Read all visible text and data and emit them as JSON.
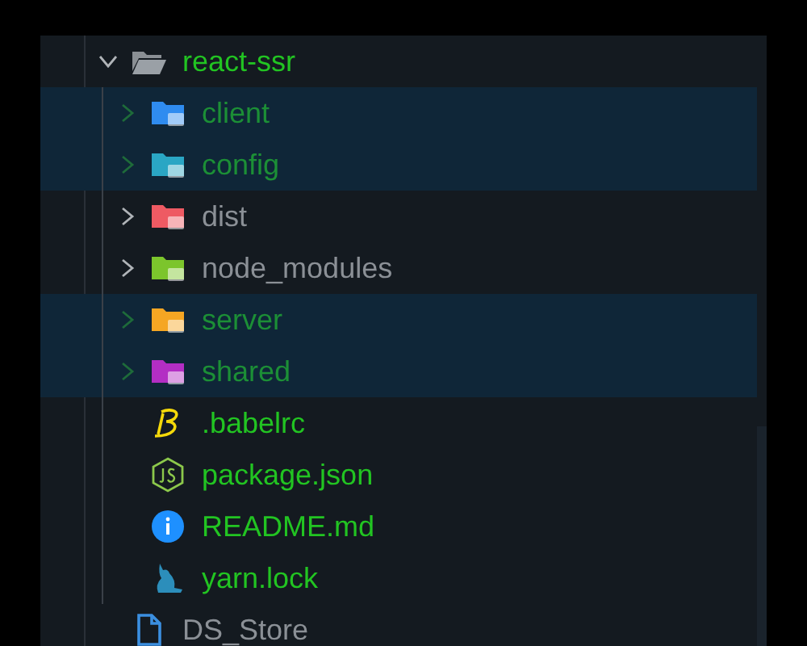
{
  "explorer": {
    "items": [
      {
        "name": "react-ssr",
        "kind": "folder",
        "expanded": true,
        "selected": false,
        "ignored": false,
        "children": [
          {
            "name": "client",
            "kind": "folder",
            "expanded": false,
            "selected": true,
            "ignored": false,
            "color": "#2f8cf0"
          },
          {
            "name": "config",
            "kind": "folder",
            "expanded": false,
            "selected": true,
            "ignored": false,
            "color": "#2aa6c4"
          },
          {
            "name": "dist",
            "kind": "folder",
            "expanded": false,
            "selected": false,
            "ignored": true,
            "color": "#ee5a63"
          },
          {
            "name": "node_modules",
            "kind": "folder",
            "expanded": false,
            "selected": false,
            "ignored": true,
            "color": "#7cc52c"
          },
          {
            "name": "server",
            "kind": "folder",
            "expanded": false,
            "selected": true,
            "ignored": false,
            "color": "#f5a623"
          },
          {
            "name": "shared",
            "kind": "folder",
            "expanded": false,
            "selected": true,
            "ignored": false,
            "color": "#b32ec4"
          },
          {
            "name": ".babelrc",
            "kind": "file",
            "selected": false,
            "ignored": false
          },
          {
            "name": "package.json",
            "kind": "file",
            "selected": false,
            "ignored": false
          },
          {
            "name": "README.md",
            "kind": "file",
            "selected": false,
            "ignored": false
          },
          {
            "name": "yarn.lock",
            "kind": "file",
            "selected": false,
            "ignored": false
          }
        ]
      },
      {
        "name": "DS_Store",
        "kind": "file",
        "selected": false,
        "ignored": true
      }
    ]
  }
}
